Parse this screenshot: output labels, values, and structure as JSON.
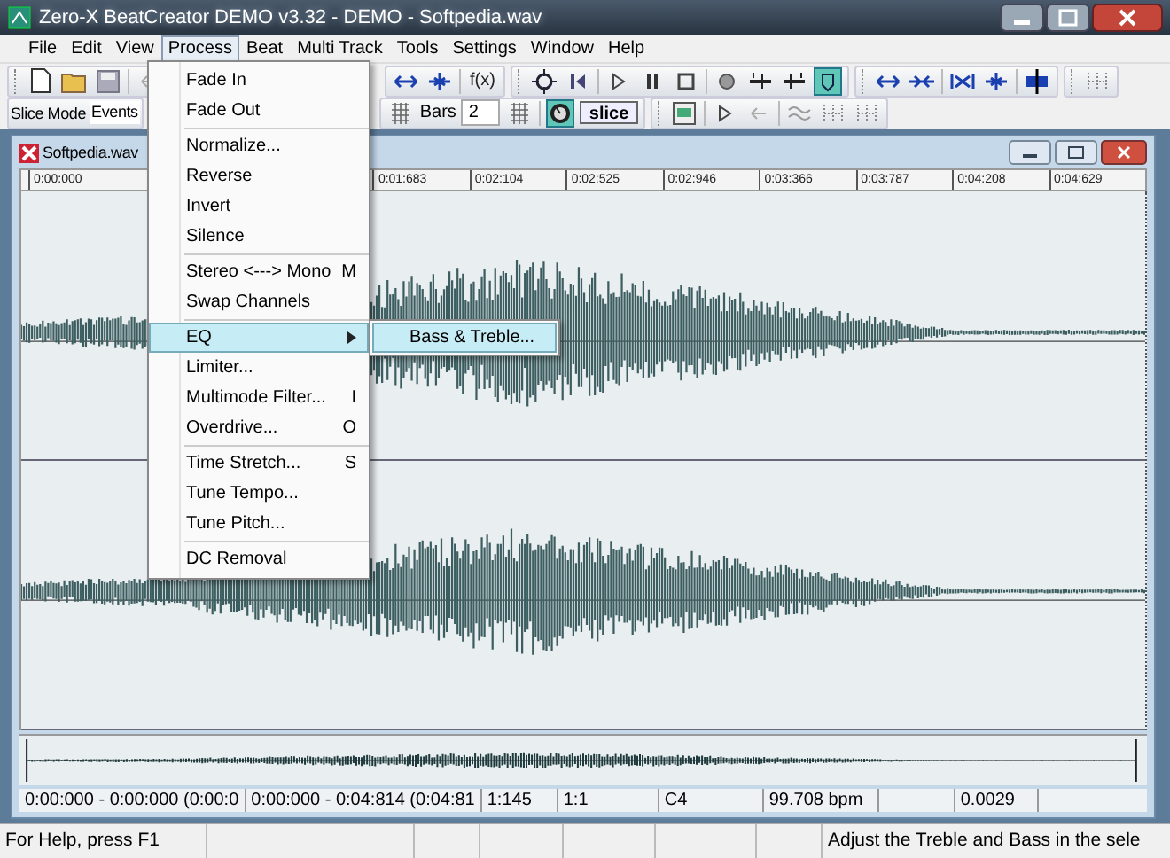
{
  "window": {
    "title": "Zero-X BeatCreator  DEMO v3.32 - DEMO - Softpedia.wav"
  },
  "menu_bar": [
    {
      "label": "File",
      "selected": false
    },
    {
      "label": "Edit",
      "selected": false
    },
    {
      "label": "View",
      "selected": false
    },
    {
      "label": "Process",
      "selected": true
    },
    {
      "label": "Beat",
      "selected": false
    },
    {
      "label": "Multi Track",
      "selected": false
    },
    {
      "label": "Tools",
      "selected": false
    },
    {
      "label": "Settings",
      "selected": false
    },
    {
      "label": "Window",
      "selected": false
    },
    {
      "label": "Help",
      "selected": false
    }
  ],
  "toolbar": {
    "function_button": "f(x)",
    "slice_mode_label": "Slice Mode",
    "slice_mode_value": "Events",
    "bars_label": "Bars",
    "bars_value": "2",
    "slice_button": "slice",
    "meter_toggle_on": true,
    "marker_toggle_on": true
  },
  "process_menu": {
    "groups": [
      [
        {
          "label": "Fade In",
          "selected": false,
          "has_submenu": false
        },
        {
          "label": "Fade Out",
          "selected": false,
          "has_submenu": false
        }
      ],
      [
        {
          "label": "Normalize...",
          "selected": false,
          "has_submenu": false
        },
        {
          "label": "Reverse",
          "selected": false,
          "has_submenu": false
        },
        {
          "label": "Invert",
          "selected": false,
          "has_submenu": false
        },
        {
          "label": "Silence",
          "selected": false,
          "has_submenu": false
        }
      ],
      [
        {
          "label": "Stereo <---> Mono",
          "shortcut": "M",
          "selected": false,
          "has_submenu": false
        },
        {
          "label": "Swap Channels",
          "selected": false,
          "has_submenu": false
        }
      ],
      [
        {
          "label": "EQ",
          "selected": true,
          "has_submenu": true
        },
        {
          "label": "Limiter...",
          "selected": false,
          "has_submenu": false
        },
        {
          "label": "Multimode Filter...",
          "shortcut": "I",
          "selected": false,
          "has_submenu": false
        },
        {
          "label": "Overdrive...",
          "shortcut": "O",
          "selected": false,
          "has_submenu": false
        }
      ],
      [
        {
          "label": "Time Stretch...",
          "shortcut": "S",
          "selected": false,
          "has_submenu": false
        },
        {
          "label": "Tune Tempo...",
          "selected": false,
          "has_submenu": false
        },
        {
          "label": "Tune Pitch...",
          "selected": false,
          "has_submenu": false
        }
      ],
      [
        {
          "label": "DC Removal",
          "selected": false,
          "has_submenu": false
        }
      ]
    ]
  },
  "submenu": [
    {
      "label": "Bass & Treble...",
      "selected": true
    }
  ],
  "document": {
    "title": "Softpedia.wav",
    "ruler": [
      "0:00:000",
      "0:01:683",
      "0:02:104",
      "0:02:525",
      "0:02:946",
      "0:03:366",
      "0:03:787",
      "0:04:208",
      "0:04:629"
    ],
    "info_bar": [
      "0:00:000 - 0:00:000 (0:00:0",
      "0:00:000 - 0:04:814 (0:04:81",
      "1:145",
      "1:1",
      "C4",
      "99.708 bpm",
      "0.0029"
    ]
  },
  "status_bar": {
    "help": "For Help, press F1",
    "message": "Adjust the Treble and Bass in the sele"
  }
}
